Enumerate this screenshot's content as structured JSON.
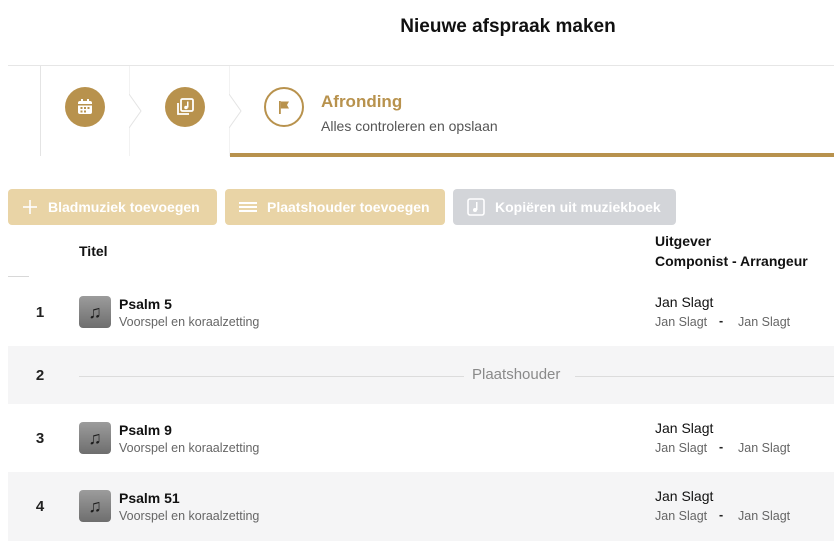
{
  "page": {
    "title": "Nieuwe afspraak maken"
  },
  "stepper": {
    "steps": [
      {
        "icon": "calendar-icon",
        "state": "done"
      },
      {
        "icon": "music-library-icon",
        "state": "done"
      },
      {
        "icon": "flag-icon",
        "state": "active",
        "title": "Afronding",
        "subtitle": "Alles controleren en opslaan"
      }
    ]
  },
  "toolbar": {
    "add_sheet_music": "Bladmuziek toevoegen",
    "add_placeholder": "Plaatshouder toevoegen",
    "copy_from_book": "Kopiëren uit muziekboek"
  },
  "table": {
    "col_title": "Titel",
    "col_publisher": "Uitgever",
    "col_composer": "Componist - Arrangeur",
    "rows": [
      {
        "num": "1",
        "type": "music",
        "title": "Psalm 5",
        "subtitle": "Voorspel en koraalzetting",
        "publisher": "Jan Slagt",
        "composer": "Jan Slagt",
        "dash": "-",
        "arranger": "Jan Slagt"
      },
      {
        "num": "2",
        "type": "placeholder",
        "label": "Plaatshouder"
      },
      {
        "num": "3",
        "type": "music",
        "title": "Psalm 9",
        "subtitle": "Voorspel en koraalzetting",
        "publisher": "Jan Slagt",
        "composer": "Jan Slagt",
        "dash": "-",
        "arranger": "Jan Slagt"
      },
      {
        "num": "4",
        "type": "music",
        "title": "Psalm 51",
        "subtitle": "Voorspel en koraalzetting",
        "publisher": "Jan Slagt",
        "composer": "Jan Slagt",
        "dash": "-",
        "arranger": "Jan Slagt"
      }
    ]
  },
  "colors": {
    "accent": "#b8924d",
    "accent_light": "#e9d4a6",
    "disabled": "#d3d5d9",
    "row_alt": "#f5f5f6"
  }
}
